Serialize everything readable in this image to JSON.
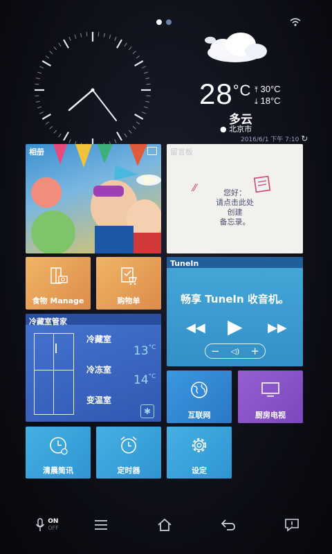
{
  "status": {
    "wifi_icon": "wifi-icon"
  },
  "pager": {
    "pages": 2,
    "active": 0
  },
  "weather": {
    "temp": "28",
    "unit": "°C",
    "high": "30°C",
    "low": "18°C",
    "condition": "多云",
    "city": "北京市",
    "updated": "2016/6/1 下午 7:10"
  },
  "tiles": {
    "album": {
      "title": "相册"
    },
    "memo": {
      "title": "留言板",
      "lines": [
        "您好：",
        "请点击此处",
        "创建",
        "备忘录。"
      ]
    },
    "food": {
      "label": "食物 Manage"
    },
    "shopping": {
      "label": "购物单"
    },
    "tunein": {
      "title": "TuneIn",
      "headline": "畅享 TuneIn 收音机。"
    },
    "fridge": {
      "title": "冷藏室管家",
      "rows": [
        {
          "name": "冷藏室",
          "temp": "13",
          "unit": "°C"
        },
        {
          "name": "冷冻室",
          "temp": "14",
          "unit": "°C"
        },
        {
          "name": "变温室",
          "temp": "",
          "unit": ""
        }
      ]
    },
    "internet": {
      "label": "互联网"
    },
    "tv": {
      "label": "厨房电视"
    },
    "news": {
      "label": "清晨简讯"
    },
    "timer": {
      "label": "定时器"
    },
    "settings": {
      "label": "设定"
    }
  },
  "bottom": {
    "mic_on": "ON",
    "mic_off": "OFF"
  },
  "colors": {
    "album_bg": "#e9c25b",
    "memo_bg": "#f2f1ee",
    "orange": "#e8a15a",
    "tunein": "#3a9fd2",
    "fridge": "#3d68c4",
    "blue": "#2f86d6",
    "purple": "#8a54c6",
    "cyan": "#3aa7da"
  }
}
